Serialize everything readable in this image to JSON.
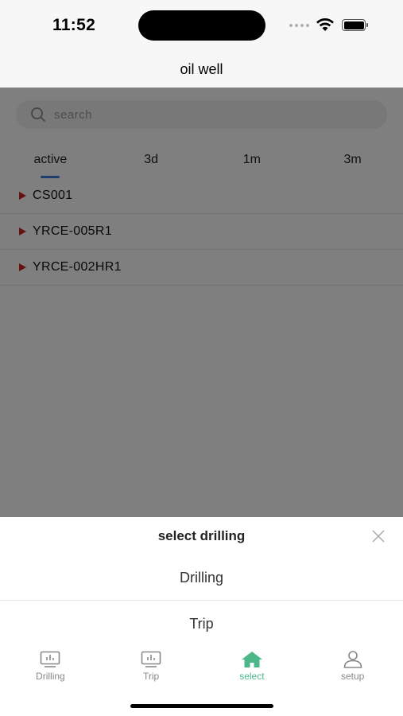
{
  "status": {
    "time": "11:52"
  },
  "nav": {
    "title": "oil well"
  },
  "search": {
    "placeholder": "search"
  },
  "tabs": [
    {
      "label": "active"
    },
    {
      "label": "3d"
    },
    {
      "label": "1m"
    },
    {
      "label": "3m"
    }
  ],
  "wells": [
    {
      "name": "CS001"
    },
    {
      "name": "YRCE-005R1"
    },
    {
      "name": "YRCE-002HR1"
    }
  ],
  "sheet": {
    "title": "select drilling",
    "options": [
      {
        "label": "Drilling"
      },
      {
        "label": "Trip"
      }
    ]
  },
  "tabbar": [
    {
      "label": "Drilling",
      "icon": "monitor-chart-icon"
    },
    {
      "label": "Trip",
      "icon": "monitor-chart-icon"
    },
    {
      "label": "select",
      "icon": "home-icon"
    },
    {
      "label": "setup",
      "icon": "user-icon"
    }
  ],
  "colors": {
    "accent": "#4cb88a",
    "tab_indicator": "#3a7bd5",
    "marker": "#cc2222"
  }
}
